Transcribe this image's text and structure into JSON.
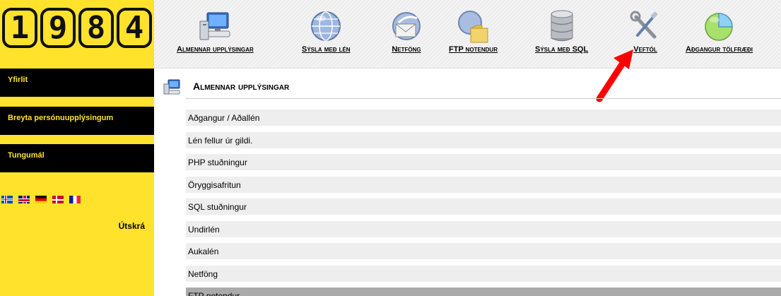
{
  "logo": {
    "digits": [
      "1",
      "9",
      "8",
      "4"
    ]
  },
  "sidebar": {
    "items": [
      {
        "label": "Yfirlit"
      },
      {
        "label": "Breyta persónuupplýsingum"
      },
      {
        "label": "Tungumál"
      }
    ],
    "flags": [
      "is-flag-icon",
      "gb-flag-icon",
      "de-flag-icon",
      "dk-flag-icon",
      "fr-flag-icon"
    ],
    "logout_label": "Útskrá"
  },
  "toolbar": {
    "items": [
      {
        "label": "Almennar upplýsingar",
        "icon": "computer-icon"
      },
      {
        "label": "Sýsla með lén",
        "icon": "globe-icon"
      },
      {
        "label": "Netföng",
        "icon": "mail-icon"
      },
      {
        "label": "FTP notendur",
        "icon": "ftp-folder-icon"
      },
      {
        "label": "Sýsla með SQL",
        "icon": "database-icon"
      },
      {
        "label": "Veftól",
        "icon": "tools-icon"
      },
      {
        "label": "Aðgangur tölfræði",
        "icon": "pie-chart-icon"
      }
    ]
  },
  "main": {
    "title": "Almennar upplýsingar",
    "items": [
      {
        "label": "Aðgangur / Aðallén"
      },
      {
        "label": "Lén fellur úr gildi."
      },
      {
        "label": "PHP stuðningur"
      },
      {
        "label": "Öryggisafritun"
      },
      {
        "label": "SQL stuðningur"
      },
      {
        "label": "Undirlén"
      },
      {
        "label": "Aukalén"
      },
      {
        "label": "Netföng"
      },
      {
        "label": "FTP notendur"
      }
    ]
  },
  "colors": {
    "brand_yellow": "#ffe22b",
    "nav_bg": "#000000",
    "arrow": "#ff0000",
    "row_bg": "#eeeeee"
  }
}
